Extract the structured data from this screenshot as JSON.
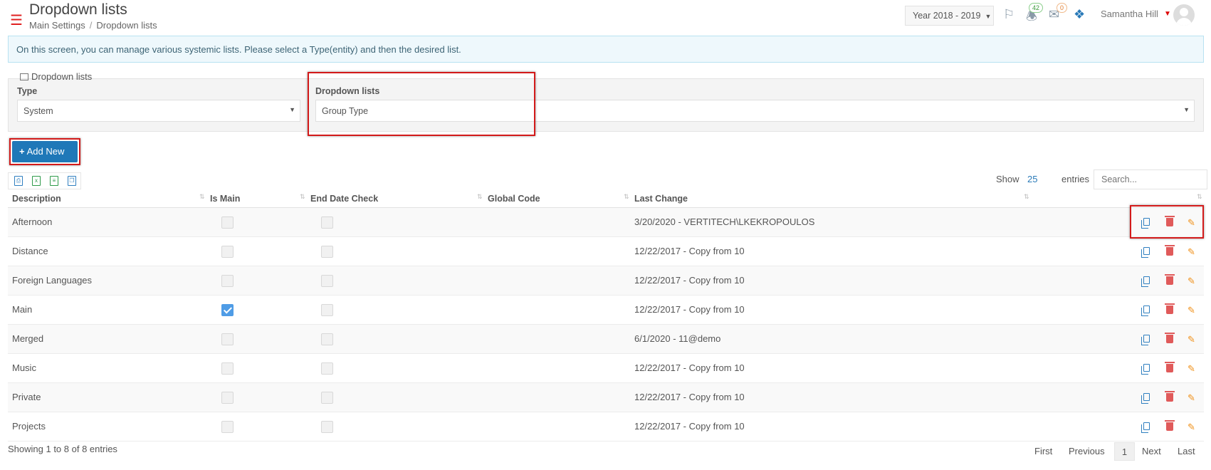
{
  "header": {
    "title": "Dropdown lists",
    "breadcrumb": [
      "Main Settings",
      "Dropdown lists"
    ],
    "year_selector": "Year 2018 - 2019",
    "notifications_count": "42",
    "messages_count": "0",
    "user_name": "Samantha Hill"
  },
  "info_text": "On this screen, you can manage various systemic lists. Please select a Type(entity) and then the desired list.",
  "filters": {
    "legend": "Dropdown lists",
    "type_label": "Type",
    "type_value": "System",
    "list_label": "Dropdown lists",
    "list_value": "Group Type"
  },
  "add_button": "Add New",
  "table_controls": {
    "show_label": "Show",
    "page_size": "25",
    "entries_label": "entries",
    "search_placeholder": "Search..."
  },
  "columns": [
    "Description",
    "Is Main",
    "End Date Check",
    "Global Code",
    "Last Change"
  ],
  "rows": [
    {
      "description": "Afternoon",
      "is_main": false,
      "end_date_check": false,
      "global_code": "",
      "last_change": "3/20/2020 - VERTITECH\\LKEKROPOULOS"
    },
    {
      "description": "Distance",
      "is_main": false,
      "end_date_check": false,
      "global_code": "",
      "last_change": "12/22/2017 - Copy from 10"
    },
    {
      "description": "Foreign Languages",
      "is_main": false,
      "end_date_check": false,
      "global_code": "",
      "last_change": "12/22/2017 - Copy from 10"
    },
    {
      "description": "Main",
      "is_main": true,
      "end_date_check": false,
      "global_code": "",
      "last_change": "12/22/2017 - Copy from 10"
    },
    {
      "description": "Merged",
      "is_main": false,
      "end_date_check": false,
      "global_code": "",
      "last_change": "6/1/2020 - 11@demo"
    },
    {
      "description": "Music",
      "is_main": false,
      "end_date_check": false,
      "global_code": "",
      "last_change": "12/22/2017 - Copy from 10"
    },
    {
      "description": "Private",
      "is_main": false,
      "end_date_check": false,
      "global_code": "",
      "last_change": "12/22/2017 - Copy from 10"
    },
    {
      "description": "Projects",
      "is_main": false,
      "end_date_check": false,
      "global_code": "",
      "last_change": "12/22/2017 - Copy from 10"
    }
  ],
  "footer": {
    "info": "Showing 1 to 8 of 8 entries",
    "first": "First",
    "previous": "Previous",
    "current_page": "1",
    "next": "Next",
    "last": "Last"
  },
  "colors": {
    "accent": "#1f78b8",
    "highlight_border": "#d31a1a",
    "delete": "#e05a5a",
    "edit": "#f0921c"
  }
}
